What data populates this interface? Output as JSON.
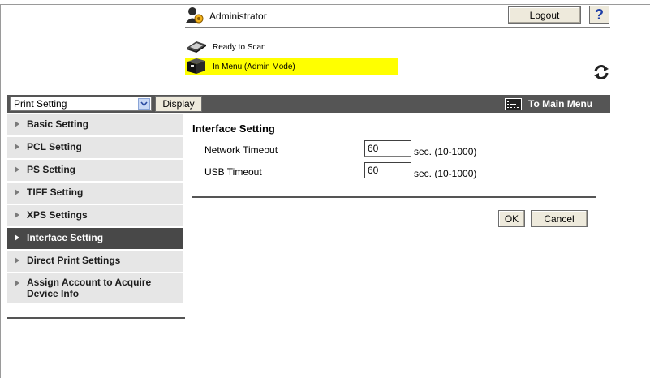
{
  "header": {
    "user_label": "Administrator",
    "logout_label": "Logout",
    "help_label": "?"
  },
  "status": {
    "scan_status": "Ready to Scan",
    "mode_status": "In Menu (Admin Mode)",
    "highlight_color": "#ffff00"
  },
  "toolbar": {
    "select_value": "Print Setting",
    "display_label": "Display",
    "to_main_label": "To Main Menu",
    "bar_color": "#555555"
  },
  "sidebar": {
    "items": [
      {
        "label": "Basic Setting"
      },
      {
        "label": "PCL Setting"
      },
      {
        "label": "PS Setting"
      },
      {
        "label": "TIFF Setting"
      },
      {
        "label": "XPS Settings"
      },
      {
        "label": "Interface Setting",
        "active": true
      },
      {
        "label": "Direct Print Settings"
      },
      {
        "label": "Assign Account to Acquire Device Info"
      }
    ]
  },
  "main": {
    "title": "Interface Setting",
    "fields": [
      {
        "label": "Network Timeout",
        "value": "60",
        "unit": "sec. (10-1000)"
      },
      {
        "label": "USB Timeout",
        "value": "60",
        "unit": "sec. (10-1000)"
      }
    ],
    "ok_label": "OK",
    "cancel_label": "Cancel"
  }
}
